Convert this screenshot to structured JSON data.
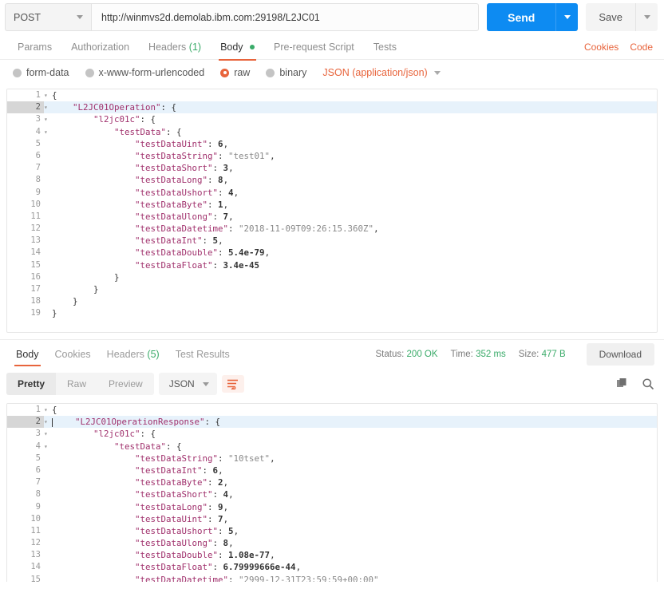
{
  "request_bar": {
    "method": "POST",
    "url": "http://winmvs2d.demolab.ibm.com:29198/L2JC01",
    "send_label": "Send",
    "save_label": "Save"
  },
  "request_tabs": {
    "items": [
      {
        "label": "Params",
        "count": "",
        "active": false,
        "dot": false
      },
      {
        "label": "Authorization",
        "count": "",
        "active": false,
        "dot": false
      },
      {
        "label": "Headers",
        "count": "(1)",
        "active": false,
        "dot": false
      },
      {
        "label": "Body",
        "count": "",
        "active": true,
        "dot": true
      },
      {
        "label": "Pre-request Script",
        "count": "",
        "active": false,
        "dot": false
      },
      {
        "label": "Tests",
        "count": "",
        "active": false,
        "dot": false
      }
    ],
    "cookies_link": "Cookies",
    "code_link": "Code"
  },
  "body_types": {
    "options": [
      {
        "label": "form-data",
        "selected": false
      },
      {
        "label": "x-www-form-urlencoded",
        "selected": false
      },
      {
        "label": "raw",
        "selected": true
      },
      {
        "label": "binary",
        "selected": false
      }
    ],
    "content_type": "JSON (application/json)"
  },
  "request_body": {
    "lines": [
      {
        "num": "1",
        "fold": "▾",
        "indent": 0,
        "active": false,
        "tokens": [
          {
            "t": "{",
            "c": "p"
          }
        ]
      },
      {
        "num": "2",
        "fold": "▾",
        "indent": 1,
        "active": true,
        "tokens": [
          {
            "t": "\"L2JC01Operation\"",
            "c": "k"
          },
          {
            "t": ": {",
            "c": "p"
          }
        ]
      },
      {
        "num": "3",
        "fold": "▾",
        "indent": 2,
        "active": false,
        "tokens": [
          {
            "t": "\"l2jc01c\"",
            "c": "k"
          },
          {
            "t": ": {",
            "c": "p"
          }
        ]
      },
      {
        "num": "4",
        "fold": "▾",
        "indent": 3,
        "active": false,
        "tokens": [
          {
            "t": "\"testData\"",
            "c": "k"
          },
          {
            "t": ": {",
            "c": "p"
          }
        ]
      },
      {
        "num": "5",
        "fold": "",
        "indent": 4,
        "active": false,
        "tokens": [
          {
            "t": "\"testDataUint\"",
            "c": "k"
          },
          {
            "t": ": ",
            "c": "p"
          },
          {
            "t": "6",
            "c": "n"
          },
          {
            "t": ",",
            "c": "p"
          }
        ]
      },
      {
        "num": "6",
        "fold": "",
        "indent": 4,
        "active": false,
        "tokens": [
          {
            "t": "\"testDataString\"",
            "c": "k"
          },
          {
            "t": ": ",
            "c": "p"
          },
          {
            "t": "\"test01\"",
            "c": "s"
          },
          {
            "t": ",",
            "c": "p"
          }
        ]
      },
      {
        "num": "7",
        "fold": "",
        "indent": 4,
        "active": false,
        "tokens": [
          {
            "t": "\"testDataShort\"",
            "c": "k"
          },
          {
            "t": ": ",
            "c": "p"
          },
          {
            "t": "3",
            "c": "n"
          },
          {
            "t": ",",
            "c": "p"
          }
        ]
      },
      {
        "num": "8",
        "fold": "",
        "indent": 4,
        "active": false,
        "tokens": [
          {
            "t": "\"testDataLong\"",
            "c": "k"
          },
          {
            "t": ": ",
            "c": "p"
          },
          {
            "t": "8",
            "c": "n"
          },
          {
            "t": ",",
            "c": "p"
          }
        ]
      },
      {
        "num": "9",
        "fold": "",
        "indent": 4,
        "active": false,
        "tokens": [
          {
            "t": "\"testDataUshort\"",
            "c": "k"
          },
          {
            "t": ": ",
            "c": "p"
          },
          {
            "t": "4",
            "c": "n"
          },
          {
            "t": ",",
            "c": "p"
          }
        ]
      },
      {
        "num": "10",
        "fold": "",
        "indent": 4,
        "active": false,
        "tokens": [
          {
            "t": "\"testDataByte\"",
            "c": "k"
          },
          {
            "t": ": ",
            "c": "p"
          },
          {
            "t": "1",
            "c": "n"
          },
          {
            "t": ",",
            "c": "p"
          }
        ]
      },
      {
        "num": "11",
        "fold": "",
        "indent": 4,
        "active": false,
        "tokens": [
          {
            "t": "\"testDataUlong\"",
            "c": "k"
          },
          {
            "t": ": ",
            "c": "p"
          },
          {
            "t": "7",
            "c": "n"
          },
          {
            "t": ",",
            "c": "p"
          }
        ]
      },
      {
        "num": "12",
        "fold": "",
        "indent": 4,
        "active": false,
        "tokens": [
          {
            "t": "\"testDataDatetime\"",
            "c": "k"
          },
          {
            "t": ": ",
            "c": "p"
          },
          {
            "t": "\"2018-11-09T09:26:15.360Z\"",
            "c": "s"
          },
          {
            "t": ",",
            "c": "p"
          }
        ]
      },
      {
        "num": "13",
        "fold": "",
        "indent": 4,
        "active": false,
        "tokens": [
          {
            "t": "\"testDataInt\"",
            "c": "k"
          },
          {
            "t": ": ",
            "c": "p"
          },
          {
            "t": "5",
            "c": "n"
          },
          {
            "t": ",",
            "c": "p"
          }
        ]
      },
      {
        "num": "14",
        "fold": "",
        "indent": 4,
        "active": false,
        "tokens": [
          {
            "t": "\"testDataDouble\"",
            "c": "k"
          },
          {
            "t": ": ",
            "c": "p"
          },
          {
            "t": "5.4e-79",
            "c": "n"
          },
          {
            "t": ",",
            "c": "p"
          }
        ]
      },
      {
        "num": "15",
        "fold": "",
        "indent": 4,
        "active": false,
        "tokens": [
          {
            "t": "\"testDataFloat\"",
            "c": "k"
          },
          {
            "t": ": ",
            "c": "p"
          },
          {
            "t": "3.4e-45",
            "c": "n"
          }
        ]
      },
      {
        "num": "16",
        "fold": "",
        "indent": 3,
        "active": false,
        "tokens": [
          {
            "t": "}",
            "c": "p"
          }
        ]
      },
      {
        "num": "17",
        "fold": "",
        "indent": 2,
        "active": false,
        "tokens": [
          {
            "t": "}",
            "c": "p"
          }
        ]
      },
      {
        "num": "18",
        "fold": "",
        "indent": 1,
        "active": false,
        "tokens": [
          {
            "t": "}",
            "c": "p"
          }
        ]
      },
      {
        "num": "19",
        "fold": "",
        "indent": 0,
        "active": false,
        "tokens": [
          {
            "t": "}",
            "c": "p"
          }
        ]
      }
    ]
  },
  "response_status": {
    "tabs": [
      {
        "label": "Body",
        "count": "",
        "active": true
      },
      {
        "label": "Cookies",
        "count": "",
        "active": false
      },
      {
        "label": "Headers",
        "count": "(5)",
        "active": false
      },
      {
        "label": "Test Results",
        "count": "",
        "active": false
      }
    ],
    "status_label": "Status:",
    "status_value": "200 OK",
    "time_label": "Time:",
    "time_value": "352 ms",
    "size_label": "Size:",
    "size_value": "477 B",
    "download_label": "Download"
  },
  "response_toolbar": {
    "views": [
      {
        "label": "Pretty",
        "active": true
      },
      {
        "label": "Raw",
        "active": false
      },
      {
        "label": "Preview",
        "active": false
      }
    ],
    "format": "JSON"
  },
  "response_body": {
    "lines": [
      {
        "num": "1",
        "fold": "▾",
        "indent": 0,
        "active": false,
        "cursor": false,
        "tokens": [
          {
            "t": "{",
            "c": "p"
          }
        ]
      },
      {
        "num": "2",
        "fold": "▾",
        "indent": 1,
        "active": true,
        "cursor": true,
        "tokens": [
          {
            "t": "\"L2JC01OperationResponse\"",
            "c": "k"
          },
          {
            "t": ": {",
            "c": "p"
          }
        ]
      },
      {
        "num": "3",
        "fold": "▾",
        "indent": 2,
        "active": false,
        "cursor": false,
        "tokens": [
          {
            "t": "\"l2jc01c\"",
            "c": "k"
          },
          {
            "t": ": {",
            "c": "p"
          }
        ]
      },
      {
        "num": "4",
        "fold": "▾",
        "indent": 3,
        "active": false,
        "cursor": false,
        "tokens": [
          {
            "t": "\"testData\"",
            "c": "k"
          },
          {
            "t": ": {",
            "c": "p"
          }
        ]
      },
      {
        "num": "5",
        "fold": "",
        "indent": 4,
        "active": false,
        "cursor": false,
        "tokens": [
          {
            "t": "\"testDataString\"",
            "c": "k"
          },
          {
            "t": ": ",
            "c": "p"
          },
          {
            "t": "\"10tset\"",
            "c": "s"
          },
          {
            "t": ",",
            "c": "p"
          }
        ]
      },
      {
        "num": "6",
        "fold": "",
        "indent": 4,
        "active": false,
        "cursor": false,
        "tokens": [
          {
            "t": "\"testDataInt\"",
            "c": "k"
          },
          {
            "t": ": ",
            "c": "p"
          },
          {
            "t": "6",
            "c": "n"
          },
          {
            "t": ",",
            "c": "p"
          }
        ]
      },
      {
        "num": "7",
        "fold": "",
        "indent": 4,
        "active": false,
        "cursor": false,
        "tokens": [
          {
            "t": "\"testDataByte\"",
            "c": "k"
          },
          {
            "t": ": ",
            "c": "p"
          },
          {
            "t": "2",
            "c": "n"
          },
          {
            "t": ",",
            "c": "p"
          }
        ]
      },
      {
        "num": "8",
        "fold": "",
        "indent": 4,
        "active": false,
        "cursor": false,
        "tokens": [
          {
            "t": "\"testDataShort\"",
            "c": "k"
          },
          {
            "t": ": ",
            "c": "p"
          },
          {
            "t": "4",
            "c": "n"
          },
          {
            "t": ",",
            "c": "p"
          }
        ]
      },
      {
        "num": "9",
        "fold": "",
        "indent": 4,
        "active": false,
        "cursor": false,
        "tokens": [
          {
            "t": "\"testDataLong\"",
            "c": "k"
          },
          {
            "t": ": ",
            "c": "p"
          },
          {
            "t": "9",
            "c": "n"
          },
          {
            "t": ",",
            "c": "p"
          }
        ]
      },
      {
        "num": "10",
        "fold": "",
        "indent": 4,
        "active": false,
        "cursor": false,
        "tokens": [
          {
            "t": "\"testDataUint\"",
            "c": "k"
          },
          {
            "t": ": ",
            "c": "p"
          },
          {
            "t": "7",
            "c": "n"
          },
          {
            "t": ",",
            "c": "p"
          }
        ]
      },
      {
        "num": "11",
        "fold": "",
        "indent": 4,
        "active": false,
        "cursor": false,
        "tokens": [
          {
            "t": "\"testDataUshort\"",
            "c": "k"
          },
          {
            "t": ": ",
            "c": "p"
          },
          {
            "t": "5",
            "c": "n"
          },
          {
            "t": ",",
            "c": "p"
          }
        ]
      },
      {
        "num": "12",
        "fold": "",
        "indent": 4,
        "active": false,
        "cursor": false,
        "tokens": [
          {
            "t": "\"testDataUlong\"",
            "c": "k"
          },
          {
            "t": ": ",
            "c": "p"
          },
          {
            "t": "8",
            "c": "n"
          },
          {
            "t": ",",
            "c": "p"
          }
        ]
      },
      {
        "num": "13",
        "fold": "",
        "indent": 4,
        "active": false,
        "cursor": false,
        "tokens": [
          {
            "t": "\"testDataDouble\"",
            "c": "k"
          },
          {
            "t": ": ",
            "c": "p"
          },
          {
            "t": "1.08e-77",
            "c": "n"
          },
          {
            "t": ",",
            "c": "p"
          }
        ]
      },
      {
        "num": "14",
        "fold": "",
        "indent": 4,
        "active": false,
        "cursor": false,
        "tokens": [
          {
            "t": "\"testDataFloat\"",
            "c": "k"
          },
          {
            "t": ": ",
            "c": "p"
          },
          {
            "t": "6.79999666e-44",
            "c": "n"
          },
          {
            "t": ",",
            "c": "p"
          }
        ]
      },
      {
        "num": "15",
        "fold": "",
        "indent": 4,
        "active": false,
        "cursor": false,
        "tokens": [
          {
            "t": "\"testDataDatetime\"",
            "c": "k"
          },
          {
            "t": ": ",
            "c": "p"
          },
          {
            "t": "\"2999-12-31T23:59:59+00:00\"",
            "c": "s"
          }
        ]
      }
    ]
  },
  "colors": {
    "send_blue": "#0d8bf2",
    "accent_orange": "#e8643c",
    "status_green": "#3aab69"
  }
}
